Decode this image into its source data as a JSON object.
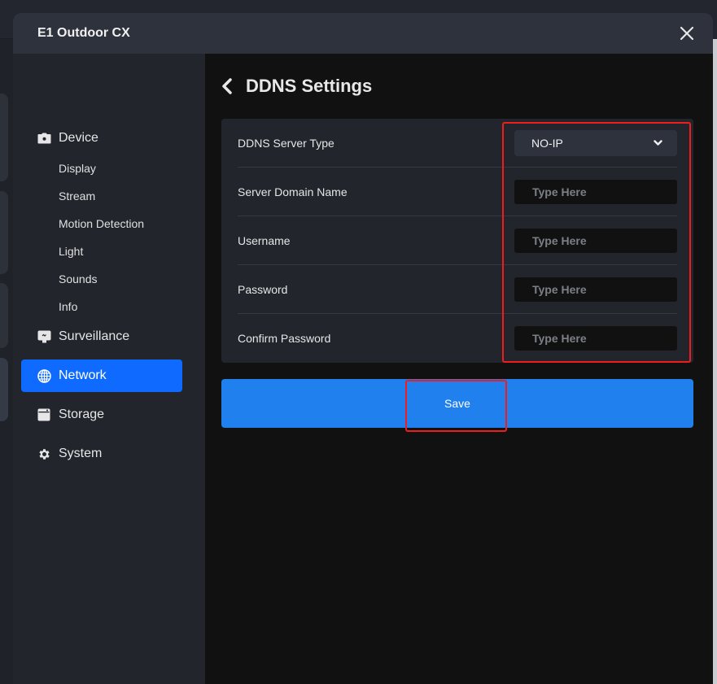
{
  "modal": {
    "title": "E1 Outdoor CX",
    "close_icon": "close-icon"
  },
  "sidebar": {
    "sections": [
      {
        "label": "Device",
        "icon": "camera-icon",
        "active": false,
        "subitems": [
          "Display",
          "Stream",
          "Motion Detection",
          "Light",
          "Sounds",
          "Info"
        ]
      },
      {
        "label": "Surveillance",
        "icon": "monitor-icon",
        "active": false
      },
      {
        "label": "Network",
        "icon": "globe-icon",
        "active": true
      },
      {
        "label": "Storage",
        "icon": "storage-icon",
        "active": false
      },
      {
        "label": "System",
        "icon": "gear-icon",
        "active": false
      }
    ]
  },
  "page": {
    "back_icon": "chevron-left-icon",
    "title": "DDNS Settings"
  },
  "form": {
    "server_type": {
      "label": "DDNS Server Type",
      "value": "NO-IP"
    },
    "domain": {
      "label": "Server Domain Name",
      "value": "",
      "placeholder": "Type Here"
    },
    "username": {
      "label": "Username",
      "value": "",
      "placeholder": "Type Here"
    },
    "password": {
      "label": "Password",
      "value": "",
      "placeholder": "Type Here"
    },
    "confirm_password": {
      "label": "Confirm Password",
      "value": "",
      "placeholder": "Type Here"
    }
  },
  "actions": {
    "save_label": "Save"
  },
  "colors": {
    "accent_active": "#0f6bff",
    "save_button": "#1f80ee",
    "annotation_highlight": "#f21c1c"
  }
}
